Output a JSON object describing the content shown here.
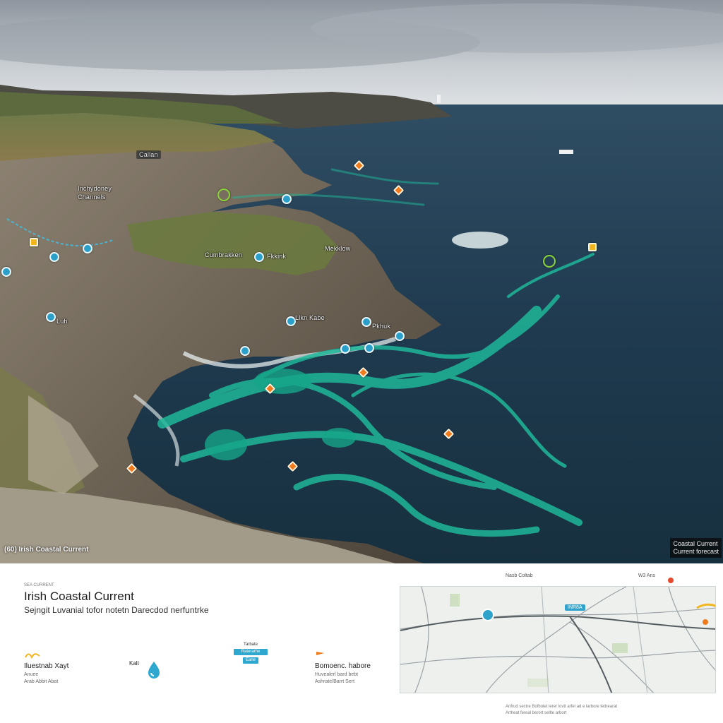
{
  "hero": {
    "caption_left": "(60) Irish Coastal Current",
    "caption_right_line1": "Coastal Current",
    "caption_right_line2": "Current forecast",
    "labels": {
      "cliff_top": "Callan",
      "headland_left": "Inchydoney",
      "headland_left_sub": "Channels",
      "mid_cliff": "Cumbrakken",
      "mid_cliff_2": "Fkkink",
      "mid_cliff_3": "Mekklow",
      "lower_cliff": "Luh",
      "lower_cliff_2": "Llkn Kabe",
      "point": "Pkhuk"
    }
  },
  "panel": {
    "tag": "SEA CURRENT",
    "title": "Irish Coastal Current",
    "subtitle": "Sejngit Luvanial tofor notetn Darecdod nerfuntrke",
    "stat1_label": "Iluestnab Xayt",
    "stat1_small": "Anuee",
    "stat1_small2": "Arab Abbit Abat",
    "stat2_label": "Kalt",
    "legend_title": "Tarbate",
    "legend_chip1": "Raterarhe",
    "legend_chip2": "Eane",
    "stat3_label": "Bomoenc. habore",
    "stat3_small": "Huvealerl bard bebt",
    "stat3_small2": "Ashrate/Barrt Sert"
  },
  "map": {
    "header_left": "Nasb Coltab",
    "header_right": "W3 Ans",
    "callout": "INR8A",
    "footer_line1": "Anfrud sectre Bofbolet lerer lovtt arfel ad e larbore ledrearat",
    "footer_line2": "Artheat fereal berort sellte arbort"
  },
  "colors": {
    "sea_deep": "#1f3a4f",
    "current_teal": "#1fb79a",
    "marker_blue": "#2a9fc9",
    "marker_orange": "#f07a1c",
    "marker_yellow": "#f2b51d",
    "map_accent": "#2fa3cb"
  }
}
